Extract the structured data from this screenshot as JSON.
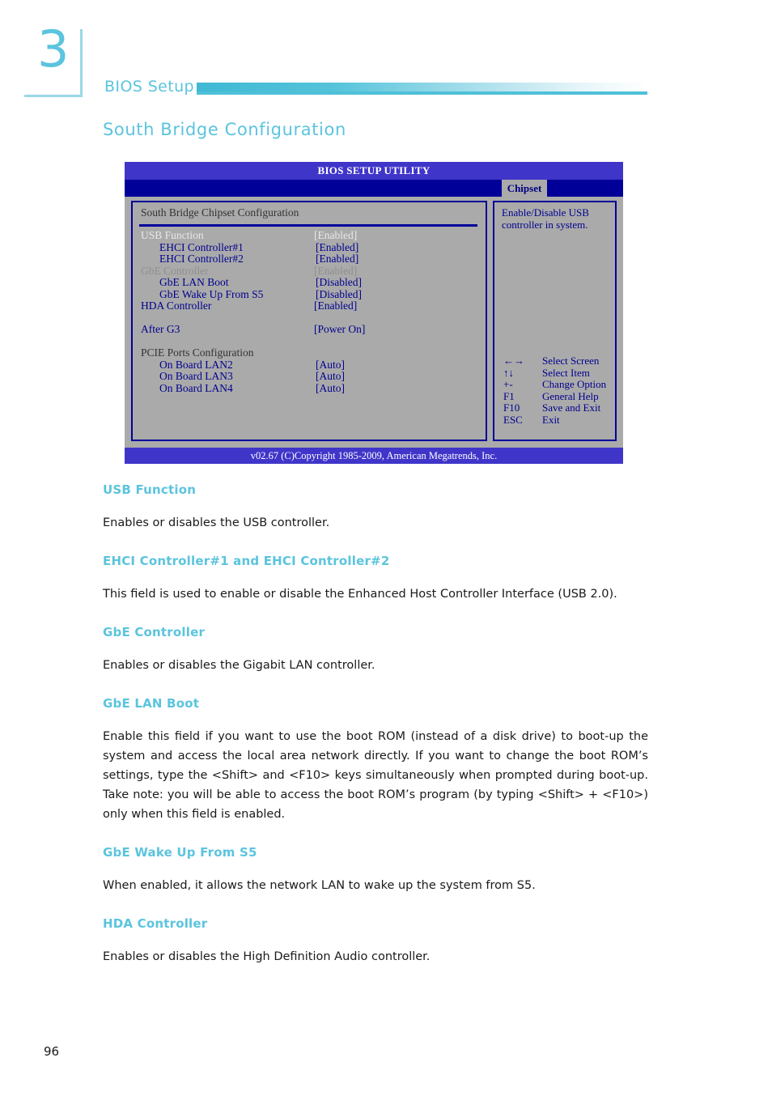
{
  "chapter": {
    "number": "3",
    "label": "BIOS Setup"
  },
  "section_title": "South Bridge Configuration",
  "bios_screen": {
    "title": "BIOS SETUP UTILITY",
    "active_tab": "Chipset",
    "panel_heading": "South Bridge Chipset Configuration",
    "rows": [
      {
        "label": "USB Function",
        "value": "[Enabled]",
        "indent": 0,
        "label_style": "c-white",
        "value_style": "c-white"
      },
      {
        "label": "EHCI Controller#1",
        "value": "[Enabled]",
        "indent": 1,
        "label_style": "c-blue",
        "value_style": "c-blue"
      },
      {
        "label": "EHCI Controller#2",
        "value": "[Enabled]",
        "indent": 1,
        "label_style": "c-blue",
        "value_style": "c-blue"
      },
      {
        "label": "GbE Controller",
        "value": "[Enabled]",
        "indent": 0,
        "label_style": "c-gray",
        "value_style": "c-gray"
      },
      {
        "label": "GbE LAN Boot",
        "value": "[Disabled]",
        "indent": 1,
        "label_style": "c-blue",
        "value_style": "c-blue"
      },
      {
        "label": "GbE Wake Up From S5",
        "value": "[Disabled]",
        "indent": 1,
        "label_style": "c-blue",
        "value_style": "c-blue"
      },
      {
        "label": "HDA Controller",
        "value": "[Enabled]",
        "indent": 0,
        "label_style": "c-blue",
        "value_style": "c-blue"
      },
      {
        "label": "",
        "value": "",
        "indent": 0,
        "label_style": "c-blue",
        "value_style": "c-blue"
      },
      {
        "label": "After G3",
        "value": "[Power On]",
        "indent": 0,
        "label_style": "c-blue",
        "value_style": "c-blue"
      },
      {
        "label": "",
        "value": "",
        "indent": 0,
        "label_style": "c-blue",
        "value_style": "c-blue"
      },
      {
        "label": "PCIE Ports Configuration",
        "value": "",
        "indent": 0,
        "label_style": "c-dark",
        "value_style": "c-dark"
      },
      {
        "label": "On Board LAN2",
        "value": "[Auto]",
        "indent": 1,
        "label_style": "c-blue",
        "value_style": "c-blue"
      },
      {
        "label": "On Board LAN3",
        "value": "[Auto]",
        "indent": 1,
        "label_style": "c-blue",
        "value_style": "c-blue"
      },
      {
        "label": "On Board LAN4",
        "value": "[Auto]",
        "indent": 1,
        "label_style": "c-blue",
        "value_style": "c-blue"
      }
    ],
    "help_text": "Enable/Disable USB controller in system.",
    "legend": [
      {
        "key": "←→",
        "desc": "Select Screen"
      },
      {
        "key": "↑↓",
        "desc": "Select Item"
      },
      {
        "key": "+-",
        "desc": "Change Option"
      },
      {
        "key": "F1",
        "desc": "General Help"
      },
      {
        "key": "F10",
        "desc": "Save and Exit"
      },
      {
        "key": "ESC",
        "desc": "Exit"
      }
    ],
    "footer": "v02.67 (C)Copyright 1985-2009, American Megatrends, Inc."
  },
  "sections": [
    {
      "heading": "USB Function",
      "body": "Enables or disables the USB controller."
    },
    {
      "heading": "EHCI Controller#1 and EHCI Controller#2",
      "body": "This field is used to enable or disable the Enhanced Host Controller Interface (USB 2.0)."
    },
    {
      "heading": "GbE Controller",
      "body": "Enables or disables the Gigabit LAN controller."
    },
    {
      "heading": "GbE LAN Boot",
      "body": "Enable this field if you want to use the boot ROM (instead of a disk drive) to boot-up the system and access the local area network directly. If you want to change the boot ROM’s settings, type the <Shift> and <F10> keys simultaneously when prompted during boot-up. Take note: you will be able to access the boot ROM’s program (by typing <Shift> + <F10>) only when this field is enabled."
    },
    {
      "heading": "GbE Wake Up From S5",
      "body": "When enabled, it allows the network LAN to wake up the system from S5."
    },
    {
      "heading": "HDA Controller",
      "body": "Enables or disables the High Definition Audio controller."
    }
  ],
  "page_number": "96",
  "colors": {
    "accent_cyan": "#5bc4de",
    "bios_titlebar": "#4035c9",
    "bios_tabbar": "#000099",
    "bios_body": "#aaaaaa",
    "bios_text_blue": "#00008f"
  }
}
